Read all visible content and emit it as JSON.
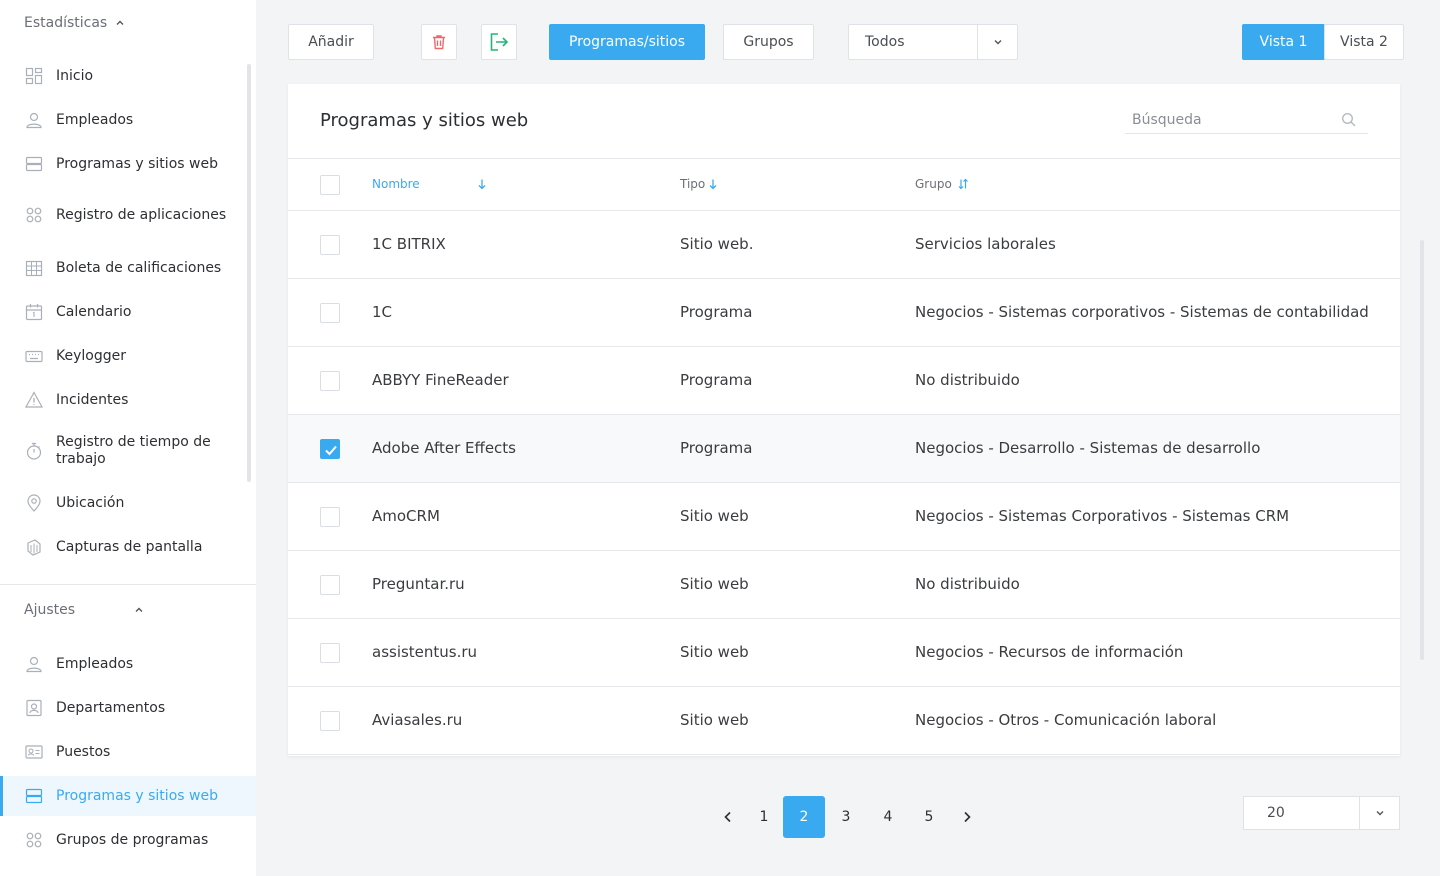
{
  "sidebar": {
    "stats_section": "Estadísticas",
    "stats_items": [
      {
        "label": "Inicio",
        "icon": "dashboard-icon"
      },
      {
        "label": "Empleados",
        "icon": "user-icon"
      },
      {
        "label": "Programas y sitios web",
        "icon": "server-icon"
      },
      {
        "label": "Registro de aplicaciones",
        "icon": "apps-icon"
      },
      {
        "label": "Boleta de calificaciones",
        "icon": "grid-calendar-icon"
      },
      {
        "label": "Calendario",
        "icon": "calendar-icon"
      },
      {
        "label": "Keylogger",
        "icon": "keyboard-icon"
      },
      {
        "label": "Incidentes",
        "icon": "warning-icon"
      },
      {
        "label": "Registro de tiempo de trabajo",
        "icon": "stopwatch-icon"
      },
      {
        "label": "Ubicación",
        "icon": "location-pin-icon"
      },
      {
        "label": "Capturas de pantalla",
        "icon": "screenshots-icon"
      }
    ],
    "settings_section": "Ajustes",
    "settings_items": [
      {
        "label": "Empleados",
        "icon": "user-icon"
      },
      {
        "label": "Departamentos",
        "icon": "department-icon"
      },
      {
        "label": "Puestos",
        "icon": "id-card-icon"
      },
      {
        "label": "Programas y sitios web",
        "icon": "server-icon",
        "active": true
      },
      {
        "label": "Grupos de programas",
        "icon": "apps-icon"
      }
    ]
  },
  "toolbar": {
    "add_label": "Añadir",
    "delete_icon": "trash-icon",
    "export_icon": "export-icon",
    "tab_programs": "Programas/sitios",
    "tab_groups": "Grupos",
    "filter_value": "Todos",
    "view1": "Vista 1",
    "view2": "Vista 2"
  },
  "card": {
    "title": "Programas y sitios web",
    "search_placeholder": "Búsqueda"
  },
  "table": {
    "columns": {
      "name": "Nombre",
      "type": "Tipo",
      "group": "Grupo"
    },
    "rows": [
      {
        "name": "1C BITRIX",
        "type": "Sitio web.",
        "group": "Servicios laborales",
        "checked": false
      },
      {
        "name": "1C",
        "type": "Programa",
        "group": "Negocios - Sistemas corporativos - Sistemas de contabilidad",
        "checked": false
      },
      {
        "name": "ABBYY FineReader",
        "type": "Programa",
        "group": "No distribuido",
        "checked": false
      },
      {
        "name": "Adobe After Effects",
        "type": "Programa",
        "group": "Negocios - Desarrollo - Sistemas de desarrollo",
        "checked": true
      },
      {
        "name": "AmoCRM",
        "type": "Sitio web",
        "group": "Negocios - Sistemas Corporativos - Sistemas CRM",
        "checked": false
      },
      {
        "name": "Preguntar.ru",
        "type": "Sitio web",
        "group": "No distribuido",
        "checked": false
      },
      {
        "name": "assistentus.ru",
        "type": "Sitio web",
        "group": "Negocios - Recursos de información",
        "checked": false
      },
      {
        "name": "Aviasales.ru",
        "type": "Sitio web",
        "group": "Negocios - Otros - Comunicación laboral",
        "checked": false
      }
    ]
  },
  "pagination": {
    "pages": [
      "1",
      "2",
      "3",
      "4",
      "5"
    ],
    "current": "2",
    "per_page": "20"
  },
  "colors": {
    "accent": "#3aaaf0",
    "delete": "#f0676b",
    "export": "#26b47a"
  }
}
